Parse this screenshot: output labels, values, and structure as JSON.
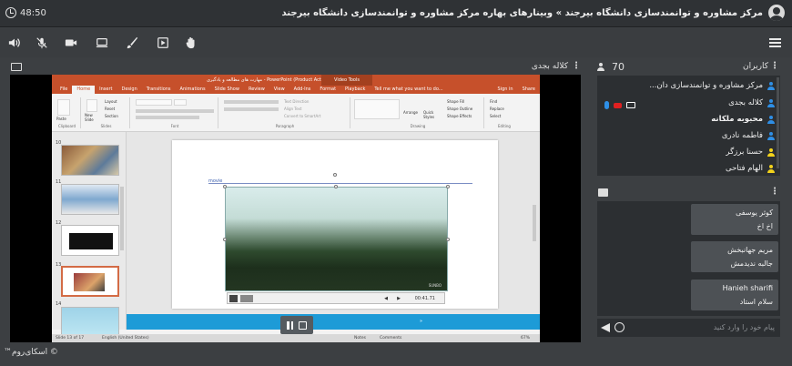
{
  "header": {
    "title": "مرکز مشاوره و توانمندسازی دانشگاه بیرجند » وبینارهای بهاره مرکز مشاوره و توانمندسازی دانشگاه بیرجند",
    "timer": "48:50"
  },
  "toolbar": {
    "items": [
      "speaker-icon",
      "mic-off-icon",
      "camera-icon",
      "screen-share-icon",
      "brush-icon",
      "media-icon",
      "raise-hand-icon",
      "menu-icon"
    ]
  },
  "presentation": {
    "presenter_name": "کلاله بجدی",
    "ppt": {
      "title_text": "مهارت های مطالعه و یادگیری - PowerPoint (Product Activation Failed)",
      "contextual_tab": "Video Tools",
      "tabs": [
        "File",
        "Home",
        "Insert",
        "Design",
        "Transitions",
        "Animations",
        "Slide Show",
        "Review",
        "View",
        "Add-Ins",
        "Format",
        "Playback",
        "Tell me what you want to do...",
        "Sign in",
        "Share"
      ],
      "ribbon_groups": [
        "Clipboard",
        "Slides",
        "Font",
        "Paragraph",
        "Drawing",
        "Editing"
      ],
      "ribbon_labels": {
        "paste": "Paste",
        "new_slide": "New Slide",
        "layout": "Layout",
        "reset": "Reset",
        "section": "Section",
        "text_direction": "Text Direction",
        "align_text": "Align Text",
        "convert_smartart": "Convert to SmartArt",
        "arrange": "Arrange",
        "quick_styles": "Quick Styles",
        "shape_fill": "Shape Fill",
        "shape_outline": "Shape Outline",
        "shape_effects": "Shape Effects",
        "find": "Find",
        "replace": "Replace",
        "select": "Select"
      },
      "thumbnails": [
        {
          "num": "10"
        },
        {
          "num": "11"
        },
        {
          "num": "12"
        },
        {
          "num": "13"
        },
        {
          "num": "14"
        }
      ],
      "slide_label": "movie",
      "video_time": "00:41.71",
      "status_left": "Slide 13 of 17",
      "status_lang": "English (United States)",
      "status_notes": "Notes",
      "status_comments": "Comments",
      "zoom": "67%"
    }
  },
  "participants": {
    "title": "کاربران",
    "count": "70",
    "users": [
      {
        "name": "مرکز مشاوره و توانمندسازی دان...",
        "role": "blue",
        "bold": false
      },
      {
        "name": "کلاله بجدی",
        "role": "blue",
        "bold": false
      },
      {
        "name": "محبوبه ملکانه",
        "role": "blue",
        "bold": true
      },
      {
        "name": "فاطمه نادری",
        "role": "blue",
        "bold": false
      },
      {
        "name": "حسنا برزگر",
        "role": "yellow",
        "bold": false
      },
      {
        "name": "الهام فتاحی",
        "role": "yellow",
        "bold": false
      }
    ]
  },
  "chat": {
    "messages": [
      {
        "sender": "کوثر یوسفی",
        "text": "اخ اخ"
      },
      {
        "sender": "مریم جهانبخش",
        "text": "جالبه ندیدمش"
      },
      {
        "sender": "Hanieh sharifi",
        "text": "سلام استاد"
      }
    ],
    "input_placeholder": "پیام خود را وارد کنید"
  },
  "footer": {
    "brand": "© اسکای‌روم™"
  }
}
